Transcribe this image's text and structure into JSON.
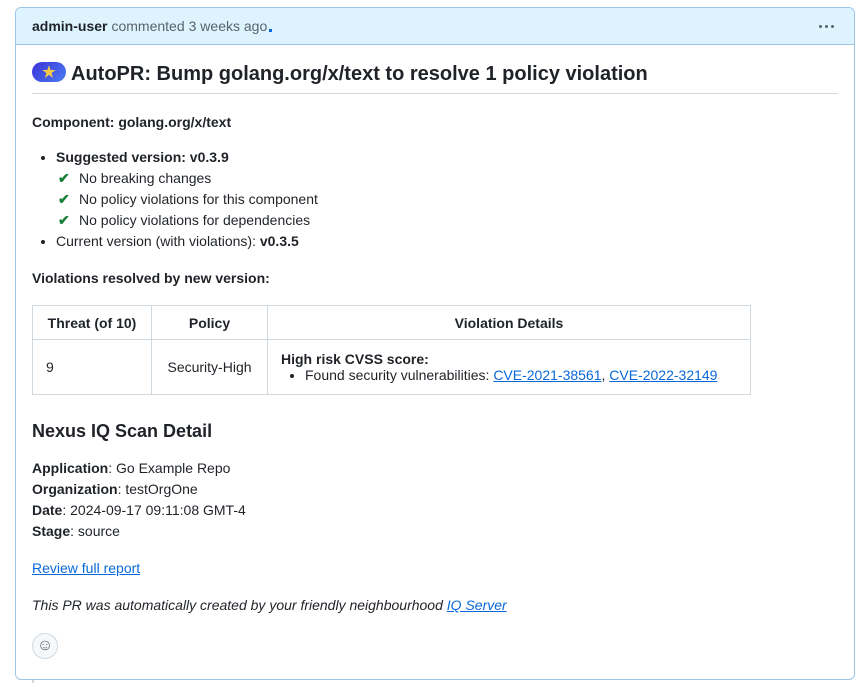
{
  "header": {
    "author": "admin-user",
    "action": "commented",
    "time": "3 weeks ago"
  },
  "title": {
    "badge_icon": "star-icon",
    "text": "AutoPR: Bump golang.org/x/text to resolve 1 policy violation"
  },
  "component": "Component: golang.org/x/text",
  "suggested": {
    "label": "Suggested version: v0.3.9",
    "checks": [
      "No breaking changes",
      "No policy violations for this component",
      "No policy violations for dependencies"
    ]
  },
  "current": {
    "label": "Current version (with violations): ",
    "version": "v0.3.5"
  },
  "resolved_heading": "Violations resolved by new version:",
  "table": {
    "headers": [
      "Threat (of 10)",
      "Policy",
      "Violation Details"
    ],
    "row": {
      "threat": "9",
      "policy": "Security-High",
      "details_title": "High risk CVSS score:",
      "details_prefix": "Found security vulnerabilities: ",
      "cve1": "CVE-2021-38561",
      "separator": ", ",
      "cve2": "CVE-2022-32149"
    }
  },
  "scan": {
    "heading": "Nexus IQ Scan Detail",
    "application_label": "Application",
    "application": ": Go Example Repo",
    "organization_label": "Organization",
    "organization": ": testOrgOne",
    "date_label": "Date",
    "date": ": 2024-09-17 09:11:08 GMT-4",
    "stage_label": "Stage",
    "stage": ": source"
  },
  "review_link": "Review full report",
  "footer": {
    "text": "This PR was automatically created by your friendly neighbourhood ",
    "link": "IQ Server"
  },
  "colors": {
    "header_bg": "#ddf4ff",
    "border": "#9ec5e6",
    "link": "#0969da",
    "check": "#1a7f37"
  }
}
